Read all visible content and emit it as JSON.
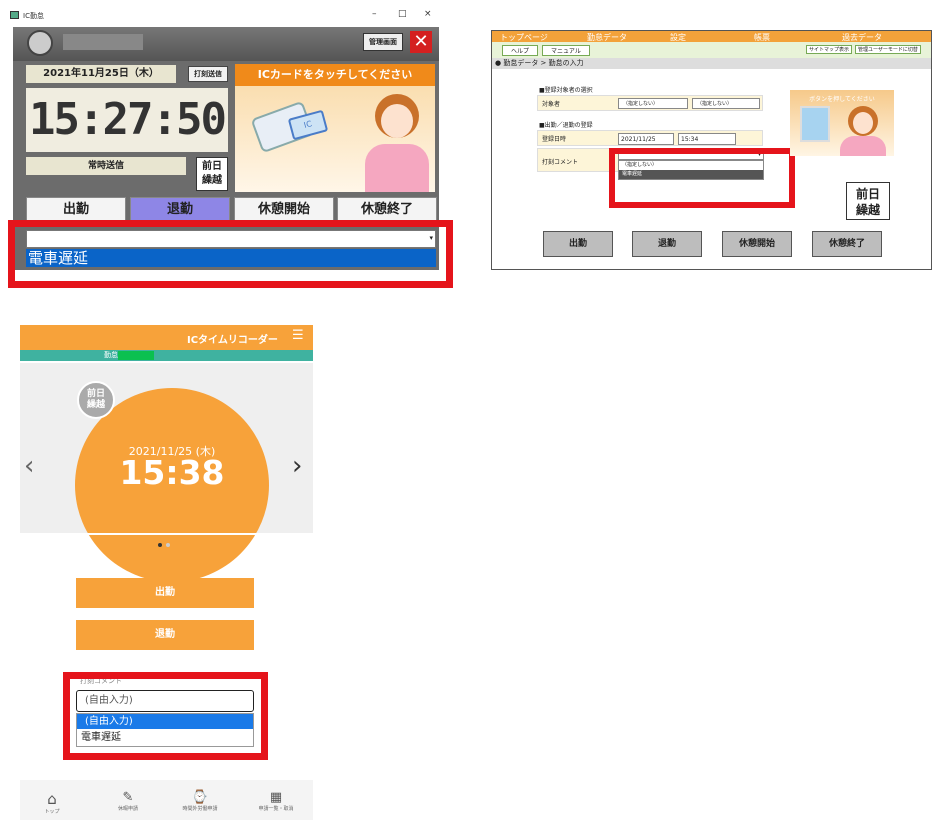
{
  "panel1": {
    "window_title": "IC勤怠",
    "admin_button": "管理画面",
    "date": "2021年11月25日（木）",
    "print_send_button": "打刻送信",
    "clock": "15:27:50",
    "mode": "常時送信",
    "prev_day_button": "前日\n繰越",
    "banner": "ICカードをタッチしてください",
    "ic_label": "IC",
    "buttons": [
      "出勤",
      "退勤",
      "休憩開始",
      "休憩終了"
    ],
    "dropdown_selected": "電車遅延"
  },
  "panel2": {
    "nav": [
      "トップページ",
      "勤怠データ",
      "設定",
      "帳票",
      "過去データ"
    ],
    "subnav": [
      "ヘルプ",
      "マニュアル"
    ],
    "subnav_right": [
      "サイトマップ表示",
      "管理ユーザーモードに切替"
    ],
    "breadcrumb": "● 勤怠データ > 勤怠の入力",
    "section1": "■登録対象者の選択",
    "target_label": "対象者",
    "select1": "（指定しない）",
    "select2": "（指定しない）",
    "section2": "■出勤／退勤の登録",
    "date_label": "登録日時",
    "date_value": "2021/11/25",
    "time_value": "15:34",
    "comment_label": "打刻コメント",
    "comment_options": [
      "（指定しない）",
      "電車遅延"
    ],
    "press_button_text": "ボタンを押してください",
    "prev_day_button": "前日\n繰越",
    "buttons": [
      "出勤",
      "退勤",
      "休憩開始",
      "休憩終了"
    ]
  },
  "panel3": {
    "app_title": "ICタイムリコーダー",
    "menu_icon": "menu-icon",
    "tab": "勤怠",
    "prev_day": "前日\n繰越",
    "date": "2021/11/25 (木)",
    "time": "15:38",
    "buttons": [
      "出勤",
      "退勤"
    ],
    "comment_label": "打刻コメント",
    "input_value": "(自由入力)",
    "options": [
      "(自由入力)",
      "電車遅延"
    ],
    "nav": [
      "トップ",
      "休暇申請",
      "時間外労働申請",
      "申請一覧・取消"
    ]
  },
  "colors": {
    "orange": "#f7a23a",
    "teal": "#3fb2a0",
    "blue": "#0a64c8",
    "red": "#e5141b"
  }
}
